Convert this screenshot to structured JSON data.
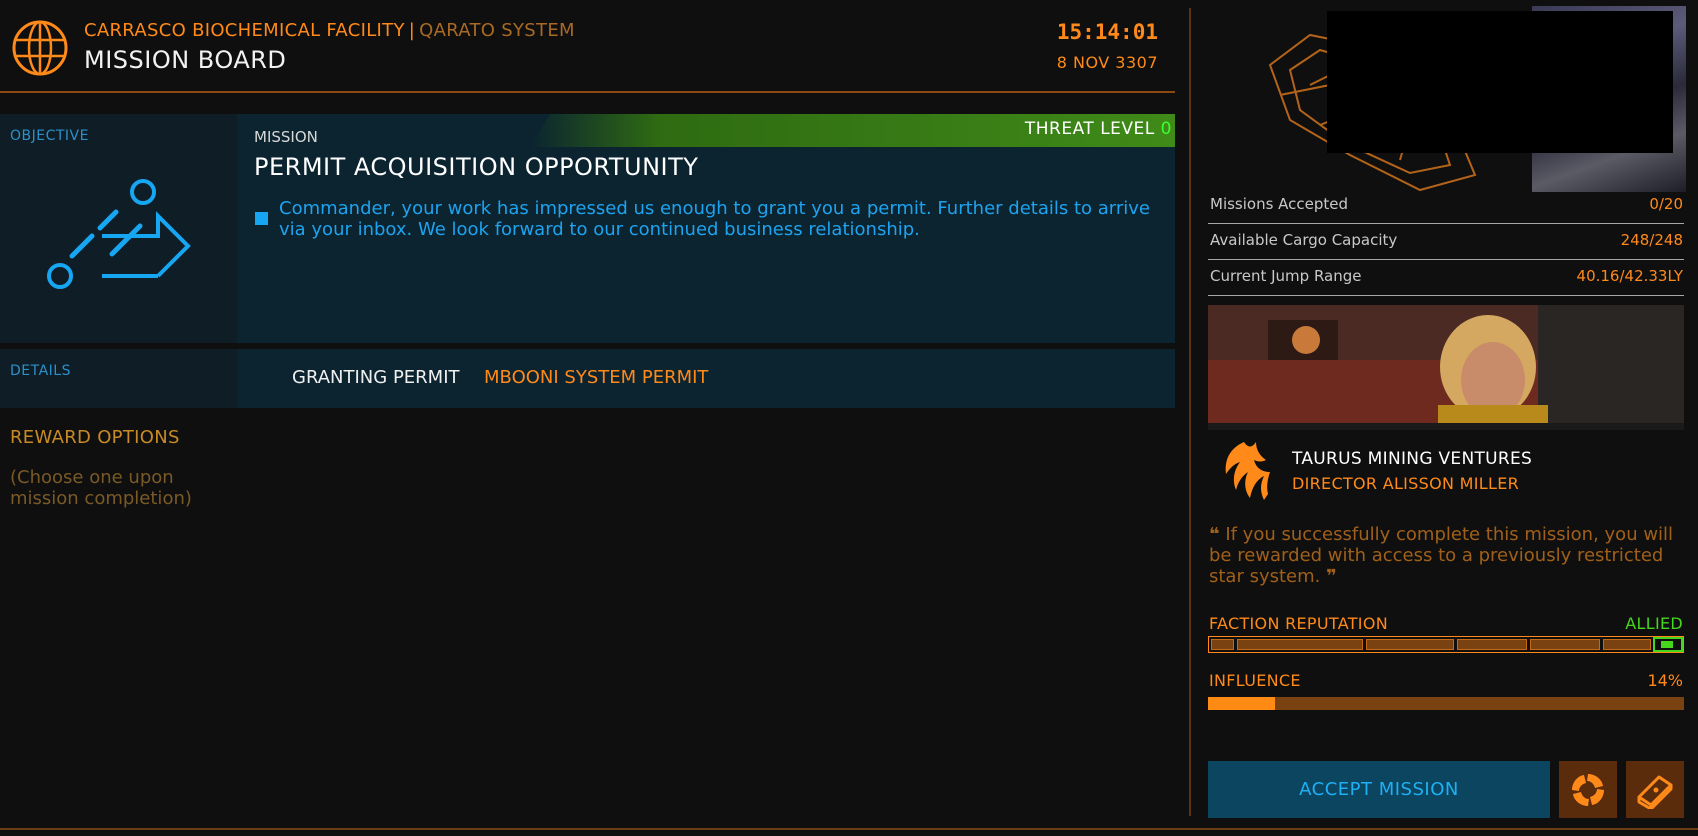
{
  "header": {
    "station": "CARRASCO BIOCHEMICAL FACILITY",
    "separator": "|",
    "system": "QARATO SYSTEM",
    "board_title": "MISSION BOARD",
    "time": "15:14:01",
    "date": "8 NOV 3307"
  },
  "objective": {
    "label": "OBJECTIVE",
    "icon": "mission-type-icon"
  },
  "mission": {
    "caption": "MISSION",
    "title": "PERMIT ACQUISITION OPPORTUNITY",
    "threat_label": "THREAT LEVEL",
    "threat_value": "0",
    "description": "Commander, your work has impressed us enough to grant you a permit. Further details to arrive via your inbox. We look forward to our continued business relationship."
  },
  "details": {
    "label": "DETAILS",
    "permit_label": "GRANTING PERMIT",
    "permit_value": "MBOONI SYSTEM PERMIT"
  },
  "reward": {
    "title": "REWARD OPTIONS",
    "subtitle": "(Choose one upon mission completion)"
  },
  "stats": [
    {
      "label": "Missions Accepted",
      "value": "0/20"
    },
    {
      "label": "Available Cargo Capacity",
      "value": "248/248"
    },
    {
      "label": "Current Jump Range",
      "value": "40.16/42.33LY"
    }
  ],
  "faction": {
    "name": "TAURUS MINING VENTURES",
    "contact": "DIRECTOR ALISSON MILLER",
    "quote": "If you successfully complete this mission, you will be rewarded with access to a previously restricted star system.",
    "reputation_label": "FACTION REPUTATION",
    "reputation_status": "ALLIED",
    "influence_label": "INFLUENCE",
    "influence_value": "14%",
    "influence_fraction": 0.14
  },
  "actions": {
    "accept_label": "ACCEPT MISSION"
  },
  "colors": {
    "accent_orange": "#ff8a1a",
    "accent_blue": "#1ea3ef",
    "allied_green": "#46d61e"
  }
}
